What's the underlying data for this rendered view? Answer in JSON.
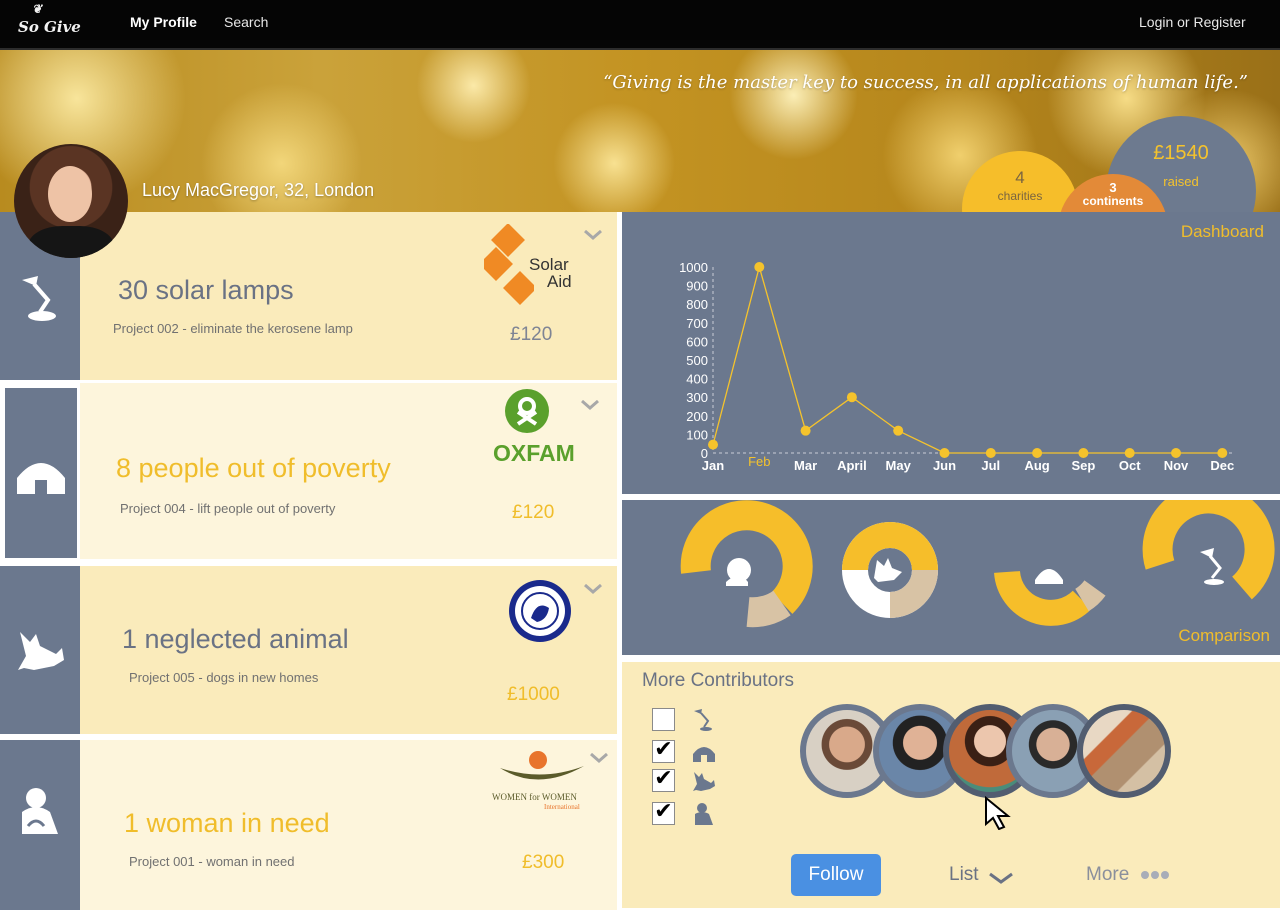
{
  "nav": {
    "logo": "So Give",
    "my_profile": "My Profile",
    "search": "Search",
    "login": "Login or Register"
  },
  "hero": {
    "quote": "“Giving is the master key to success, in all applications of human life.”",
    "user": "Lucy MacGregor, 32, London",
    "raised_value": "£1540",
    "raised_label": "raised",
    "charities_value": "4",
    "charities_label": "charities",
    "continents_value": "3",
    "continents_label": "continents"
  },
  "cards": [
    {
      "headline": "30 solar lamps",
      "project": "Project 002 - eliminate the kerosene lamp",
      "amount": "£120",
      "logo_top": "Solar",
      "logo_bottom": "Aid",
      "icon": "lamp-icon"
    },
    {
      "headline": "8 people out of poverty",
      "project": "Project 004 - lift people out of poverty",
      "amount": "£120",
      "logo": "OXFAM",
      "icon": "house-icon"
    },
    {
      "headline": "1 neglected animal",
      "project": "Project 005 - dogs in new homes",
      "amount": "£1000",
      "logo": "BATTERSEA DOGS & CATS HOME",
      "icon": "dog-icon"
    },
    {
      "headline": "1 woman in need",
      "project": "Project 001 - woman in need",
      "amount": "£300",
      "logo_top": "WOMEN for WOMEN",
      "logo_bottom": "International",
      "icon": "woman-icon"
    }
  ],
  "dashboard": {
    "title": "Dashboard"
  },
  "comparison": {
    "title": "Comparison"
  },
  "contributors": {
    "title": "More Contributors",
    "follow": "Follow",
    "list": "List",
    "more": "More",
    "filters": [
      {
        "icon": "lamp-icon",
        "checked": false
      },
      {
        "icon": "house-icon",
        "checked": true
      },
      {
        "icon": "dog-icon",
        "checked": true
      },
      {
        "icon": "woman-icon",
        "checked": true
      }
    ]
  },
  "chart_data": {
    "type": "line",
    "categories": [
      "Jan",
      "Feb",
      "Mar",
      "April",
      "May",
      "Jun",
      "Jul",
      "Aug",
      "Sep",
      "Oct",
      "Nov",
      "Dec"
    ],
    "values": [
      45,
      1000,
      120,
      300,
      120,
      0,
      0,
      0,
      0,
      0,
      0,
      0
    ],
    "yticks": [
      0,
      100,
      200,
      300,
      400,
      500,
      600,
      700,
      800,
      900,
      1000
    ],
    "ylim": [
      0,
      1000
    ],
    "highlight": "Feb",
    "color": "#f5c32c"
  }
}
